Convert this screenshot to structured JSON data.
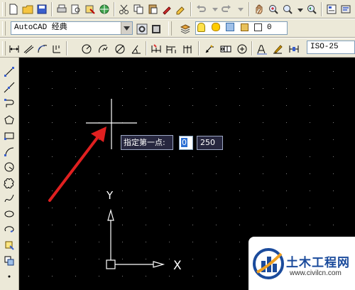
{
  "toolbars": {
    "workspace_label": "AutoCAD 经典",
    "layer_value": "0",
    "dim_style_value": "ISO-25"
  },
  "command": {
    "prompt": "指定第一点:",
    "x_value": "0",
    "y_value": "250"
  },
  "ucs": {
    "x_label": "X",
    "y_label": "Y"
  },
  "watermark": {
    "title": "土木工程网",
    "url": "www.civilcn.com"
  },
  "colors": {
    "toolbar_bg": "#ece9d8",
    "canvas_bg": "#000000",
    "prompt_bg": "#27273f",
    "arrow_red": "#e02020",
    "watermark_blue": "#1b4b9c"
  }
}
